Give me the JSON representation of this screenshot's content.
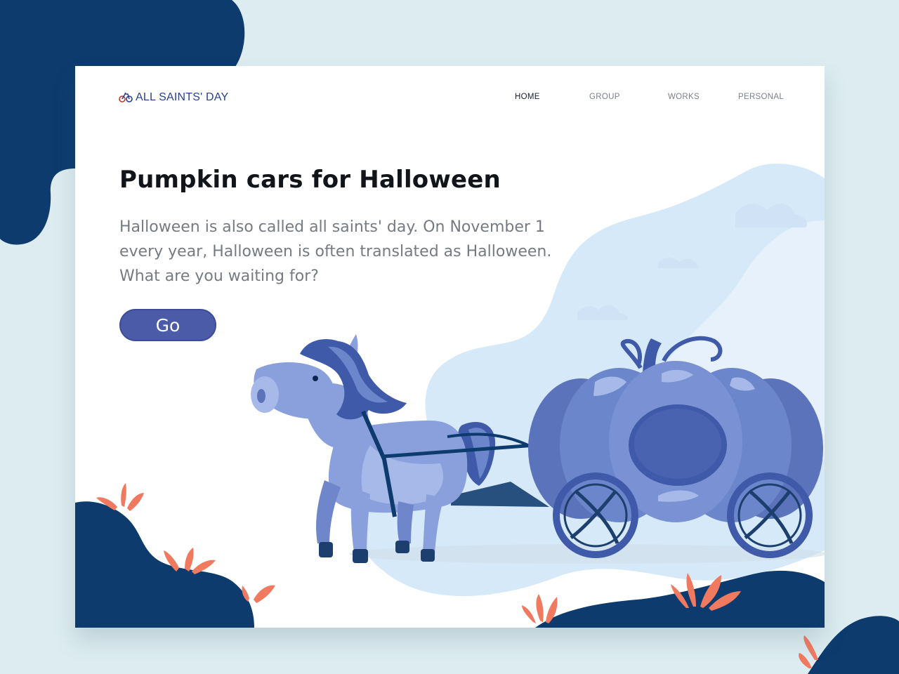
{
  "brand": {
    "name": "ALL SAINTS' DAY",
    "logo_icon": "bicycle-icon"
  },
  "nav": {
    "items": [
      "HOME",
      "GROUP",
      "WORKS",
      "PERSONAL"
    ],
    "active": "HOME"
  },
  "hero": {
    "title": "Pumpkin cars for Halloween",
    "description": "Halloween is also called all saints' day. On November 1 every year, Halloween is often translated as Halloween. What are you waiting for?",
    "button_label": "Go"
  },
  "colors": {
    "page_background": "#dcecf0",
    "navy_blob": "#0d3b6e",
    "accent": "#4b5ba7",
    "brand_text": "#2a3f8f",
    "coral_plant": "#f07a60",
    "sky_blob": "#d6e9f8"
  },
  "illustration": {
    "subject": "horse-drawn-pumpkin-carriage"
  }
}
